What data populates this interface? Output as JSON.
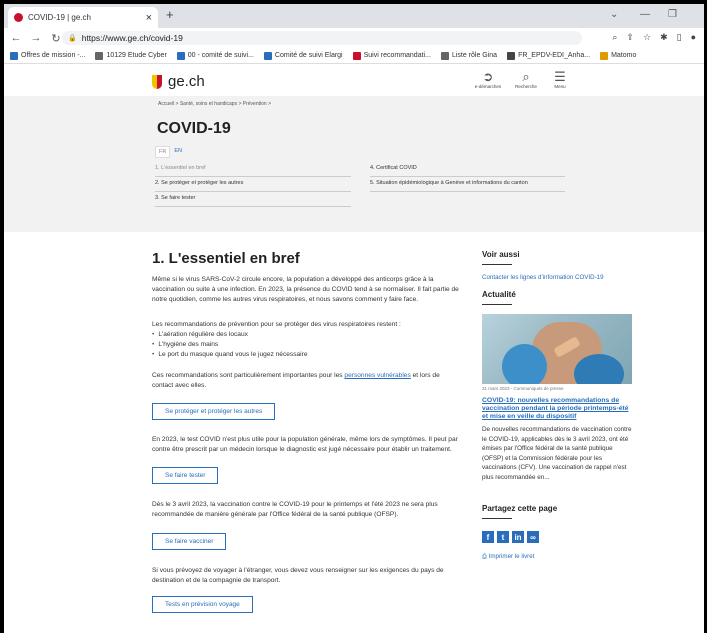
{
  "browser": {
    "tab_title": "COVID-19 | ge.ch",
    "tab_close": "×",
    "new_tab": "+",
    "url": "https://www.ge.ch/covid-19",
    "bookmarks": [
      {
        "label": "Offres de mission -...",
        "color": "#2a6ebb"
      },
      {
        "label": "10129 Etude Cyber",
        "color": "#666666"
      },
      {
        "label": "00 - comité de suivi...",
        "color": "#2a6ebb"
      },
      {
        "label": "Comité de suivi Elargi",
        "color": "#2a6ebb"
      },
      {
        "label": "Suivi recommandati...",
        "color": "#c8102e"
      },
      {
        "label": "Liste rôle Gina",
        "color": "#666666"
      },
      {
        "label": "FR_EPDV-EDI_Anha...",
        "color": "#444444"
      },
      {
        "label": "Matomo",
        "color": "#e09b00"
      }
    ]
  },
  "site": {
    "logo_text": "ge.ch",
    "nav": [
      {
        "label": "e-démarches",
        "icon": "e-demarches-icon"
      },
      {
        "label": "Recherche",
        "icon": "search-icon"
      },
      {
        "label": "Menu",
        "icon": "menu-icon"
      }
    ]
  },
  "hero": {
    "breadcrumb": "Accueil  >  Santé, soins et handicaps  >  Prévention  >",
    "title": "COVID-19",
    "lang_active": "FR",
    "lang_other": "EN",
    "toc": [
      "1. L'essentiel en bref",
      "2. Se protéger et protéger les autres",
      "3. Se faire tester",
      "4. Certificat COVID",
      "5. Situation épidémiologique à Genève et informations du canton"
    ]
  },
  "main": {
    "title": "1. L'essentiel en bref",
    "p1": "Même si le virus SARS-CoV-2 circule encore, la population a développé des anticorps grâce à la vaccination ou suite à une infection. En 2023, la présence du COVID tend à se normaliser. Il fait partie de notre quotidien, comme les autres virus respiratoires, et nous savons comment y faire face.",
    "p2": "Les recommandations de prévention pour se protéger des virus respiratoires restent :",
    "bullets": [
      "L'aération régulière des locaux",
      "L'hygiène des mains",
      "Le port du masque quand vous le jugez nécessaire"
    ],
    "p3_before": "Ces recommandations sont particulièrement importantes pour les ",
    "p3_link": "personnes vulnérables",
    "p3_after": " et lors de contact avec elles.",
    "btn1": "Se protéger et protéger les autres",
    "p4": "En 2023, le test COVID n'est plus utile pour la population générale, même lors de symptômes. Il peut par contre être prescrit par un médecin lorsque le diagnostic est jugé nécessaire pour établir un traitement.",
    "btn2": "Se faire tester",
    "p5": "Dès le 3 avril 2023, la vaccination contre le COVID-19 pour le printemps et l'été 2023 ne sera plus recommandée de manière générale par l'Office fédéral de la santé publique (OFSP).",
    "btn3": "Se faire vacciner",
    "p6": "Si vous prévoyez de voyager à l'étranger, vous devez vous renseigner sur les exigences du pays de destination et de la compagnie de transport.",
    "btn4": "Tests en prévision voyage"
  },
  "sidebar": {
    "voir_aussi": "Voir aussi",
    "voir_link": "Contacter les lignes d'information COVID-19",
    "actualite": "Actualité",
    "caption": "31 mars 2023 - Communiqués de presse",
    "news_title": "COVID-19: nouvelles recommandations de vaccination pendant la période printemps-été et mise en veille du dispositif",
    "news_body": "De nouvelles recommandations de vaccination contre le COVID-19, applicables dès le 3 avril 2023, ont été émises par l'Office fédéral de la santé publique (OFSP) et la Commission fédérale pour les vaccinations (CFV). Une vaccination de rappel n'est plus recommandée en...",
    "share_title": "Partagez cette page",
    "social": [
      "f",
      "t",
      "in",
      "∞"
    ],
    "print": "Imprimer le livret"
  }
}
